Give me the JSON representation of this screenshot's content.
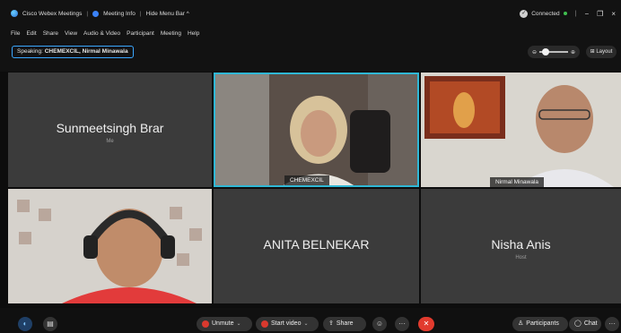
{
  "titlebar": {
    "app_title": "Cisco Webex Meetings",
    "meeting_info": "Meeting Info",
    "hide_menu": "Hide Menu Bar ^",
    "status": "Connected",
    "status_color": "#3fbf4f",
    "minimize": "−",
    "restore": "❐",
    "close": "×"
  },
  "menu": [
    "File",
    "Edit",
    "Share",
    "View",
    "Audio & Video",
    "Participant",
    "Meeting",
    "Help"
  ],
  "speaking": {
    "prefix": "Speaking:",
    "names": "CHEMEXCIL, Nirmal Minawala"
  },
  "zoom": {
    "minus": "⊖",
    "plus": "⊕"
  },
  "layout_label": "Layout",
  "participants": [
    {
      "name": "Sunmeetsingh Brar",
      "sub": "Me"
    },
    {
      "name": "CHEMEXCIL"
    },
    {
      "name": "Nirmal Minawala"
    },
    {
      "name": "ANITA BELNEKAR"
    },
    {
      "name": "Nisha Anis",
      "sub": "Host"
    }
  ],
  "controls": {
    "unmute": "Unmute",
    "start_video": "Start video",
    "share": "Share",
    "participants": "Participants",
    "chat": "Chat",
    "more": "···",
    "end": "✕"
  },
  "colors": {
    "accent": "#2fb8d6",
    "end_call": "#e23b2e",
    "mute_red": "#d9392e"
  }
}
